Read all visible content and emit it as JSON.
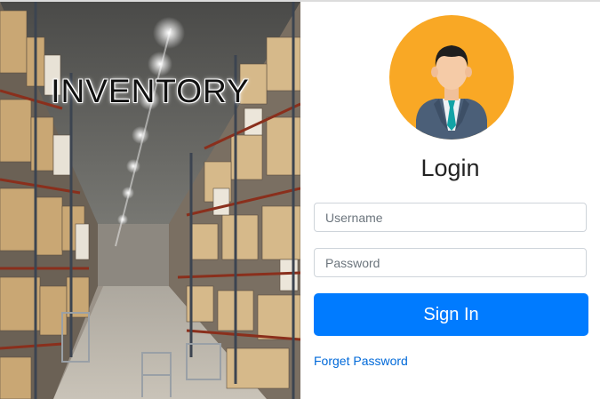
{
  "hero": {
    "title": "INVENTORY",
    "image": "warehouse-aisle-image"
  },
  "login": {
    "avatar": "user-avatar-icon",
    "heading": "Login",
    "username_placeholder": "Username",
    "password_placeholder": "Password",
    "submit_label": "Sign In",
    "forgot_label": "Forget Password"
  },
  "colors": {
    "accent": "#007bff",
    "avatar_bg": "#f9a825",
    "link": "#0069d9"
  }
}
